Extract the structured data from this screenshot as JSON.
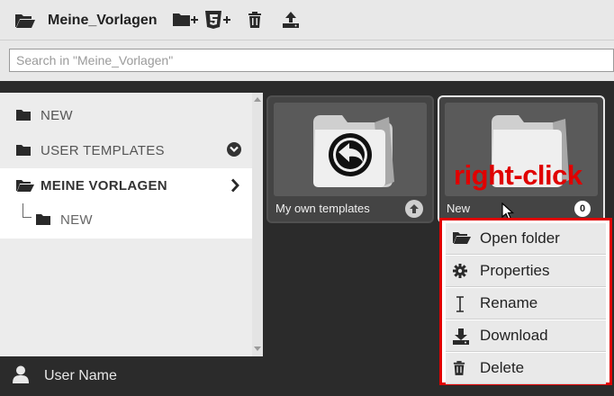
{
  "toolbar": {
    "title": "Meine_Vorlagen",
    "buttons": [
      {
        "name": "new-folder",
        "icon": "folder-plus-icon"
      },
      {
        "name": "new-html5",
        "icon": "html5-plus-icon"
      },
      {
        "name": "delete",
        "icon": "trash-icon"
      },
      {
        "name": "upload",
        "icon": "upload-icon"
      }
    ]
  },
  "search": {
    "placeholder": "Search in \"Meine_Vorlagen\"",
    "value": ""
  },
  "sidebar": {
    "items": [
      {
        "label": "NEW",
        "icon": "folder-icon",
        "active": false
      },
      {
        "label": "USER TEMPLATES",
        "icon": "folder-icon",
        "active": false,
        "indicator": "chevron-down-icon"
      },
      {
        "label": "MEINE VORLAGEN",
        "icon": "folder-open-icon",
        "active": true,
        "indicator": "chevron-right-icon"
      }
    ],
    "sub_items": [
      {
        "label": "NEW",
        "icon": "folder-icon"
      }
    ]
  },
  "user": {
    "name": "User Name",
    "icon": "user-icon"
  },
  "tiles": [
    {
      "name": "My own templates",
      "icon": "arrow-up-circle-icon",
      "thumb_icon": "folder-back-icon"
    },
    {
      "name": "New",
      "badge": "0",
      "thumb_icon": "folder-icon",
      "selected": true
    }
  ],
  "annotation": "right-click",
  "context_menu": {
    "items": [
      {
        "label": "Open folder",
        "icon": "folder-open-icon"
      },
      {
        "label": "Properties",
        "icon": "gear-icon"
      },
      {
        "label": "Rename",
        "icon": "text-cursor-icon"
      },
      {
        "label": "Download",
        "icon": "download-icon"
      },
      {
        "label": "Delete",
        "icon": "trash-icon"
      }
    ]
  },
  "colors": {
    "accent": "#e00000",
    "dark_bg": "#2b2b2b",
    "toolbar_bg": "#e8e8e8"
  }
}
